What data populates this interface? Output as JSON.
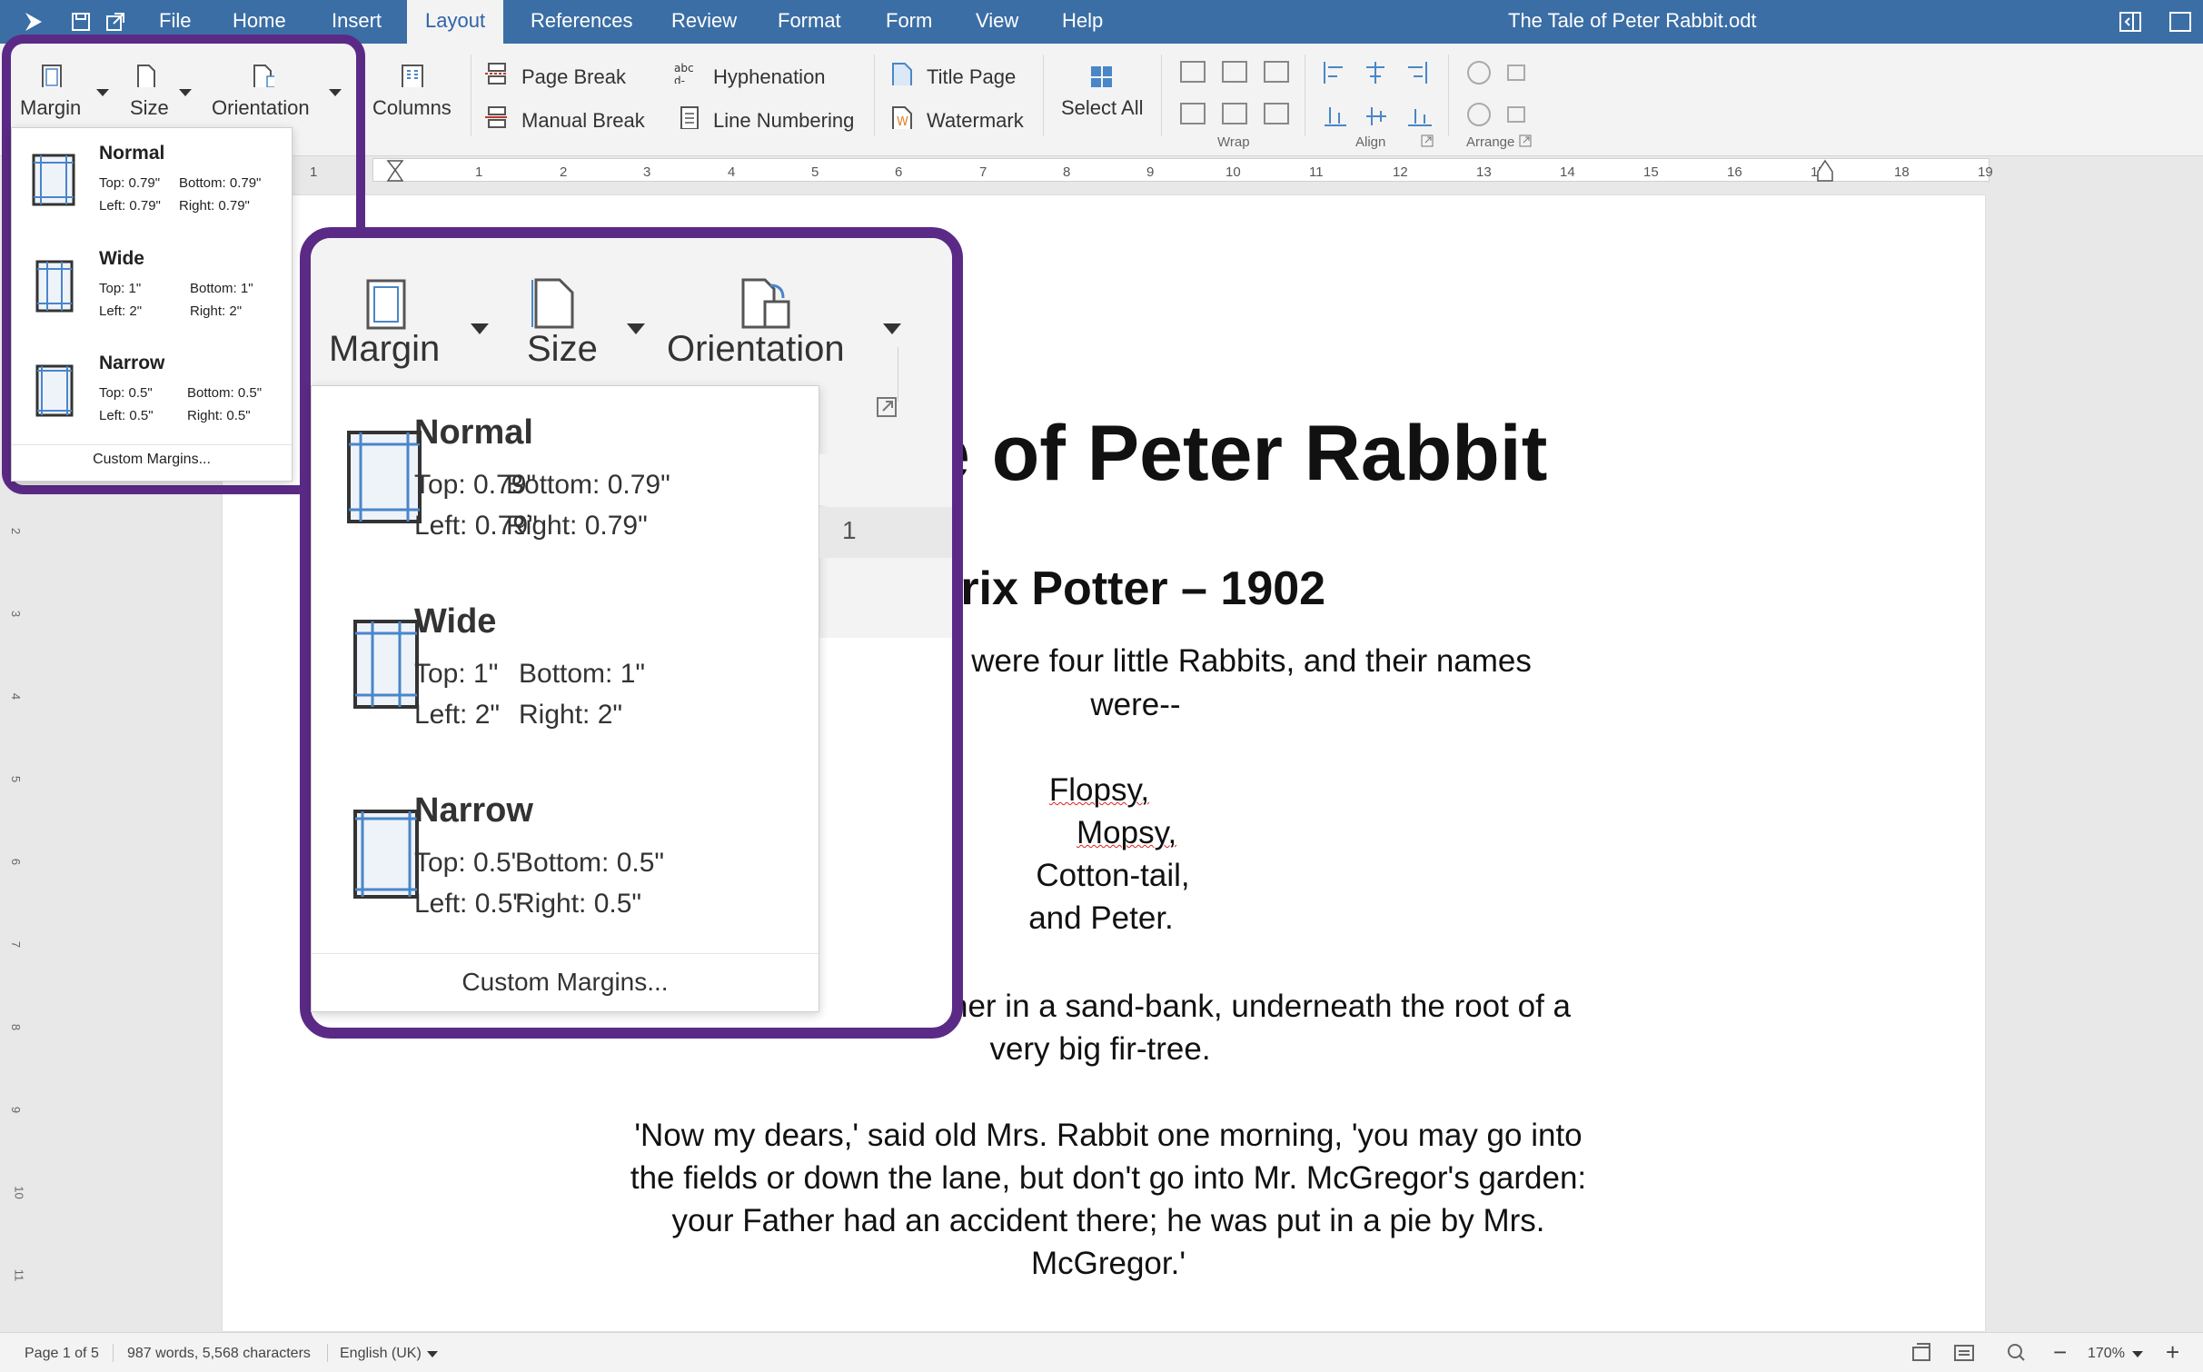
{
  "menubar": {
    "items": [
      "File",
      "Home",
      "Insert",
      "Layout",
      "References",
      "Review",
      "Format",
      "Form",
      "View",
      "Help"
    ],
    "active": "Layout",
    "doc_title": "The Tale of Peter Rabbit.odt"
  },
  "ribbon": {
    "margin": "Margin",
    "size": "Size",
    "orientation": "Orientation",
    "columns": "Columns",
    "page_break": "Page Break",
    "manual_break": "Manual Break",
    "hyphenation": "Hyphenation",
    "line_numbering": "Line Numbering",
    "title_page": "Title Page",
    "watermark": "Watermark",
    "select_all": "Select All",
    "wrap": "Wrap",
    "align": "Align",
    "arrange": "Arrange"
  },
  "margin_menu": {
    "options": [
      {
        "name": "Normal",
        "top": "Top: 0.79\"",
        "bottom": "Bottom: 0.79\"",
        "left": "Left: 0.79\"",
        "right": "Right: 0.79\""
      },
      {
        "name": "Wide",
        "top": "Top: 1\"",
        "bottom": "Bottom: 1\"",
        "left": "Left: 2\"",
        "right": "Right: 2\""
      },
      {
        "name": "Narrow",
        "top": "Top: 0.5\"",
        "bottom": "Bottom: 0.5\"",
        "left": "Left: 0.5\"",
        "right": "Right: 0.5\""
      }
    ],
    "custom": "Custom Margins..."
  },
  "ruler": {
    "numbers": [
      "1",
      "1",
      "2",
      "3",
      "4",
      "5",
      "6",
      "7",
      "8",
      "9",
      "10",
      "11",
      "12",
      "13",
      "14",
      "15",
      "16",
      "17",
      "18",
      "19"
    ],
    "zoom_ruler_number": "1"
  },
  "vruler": {
    "numbers": [
      "2",
      "3",
      "4",
      "5",
      "6",
      "7",
      "8",
      "9",
      "10",
      "11"
    ]
  },
  "document": {
    "title_visible": "e of Peter Rabbit",
    "subtitle_visible": "trix Potter – 1902",
    "p1_line1": "e were four little Rabbits, and their names",
    "p1_line2": "were--",
    "names": [
      "Flopsy,",
      "Mopsy,",
      "Cotton-tail,",
      "and Peter."
    ],
    "p2_line1": "her in a sand-bank, underneath the root of a",
    "p2_line2": "very big fir-tree.",
    "p3_lines": [
      "'Now my dears,' said old Mrs. Rabbit one morning, 'you may go into",
      "the fields or down the lane, but don't go into Mr. McGregor's garden:",
      "your Father had an accident there; he was put in a pie by Mrs.",
      "McGregor.'"
    ]
  },
  "status": {
    "page": "Page 1 of 5",
    "words": "987 words, 5,568 characters",
    "language": "English (UK)",
    "zoom": "170%"
  },
  "colors": {
    "menubar": "#3b6ea5",
    "callout": "#5b2a86",
    "icon_blue": "#4a86c8",
    "spellcheck": "#d22"
  }
}
